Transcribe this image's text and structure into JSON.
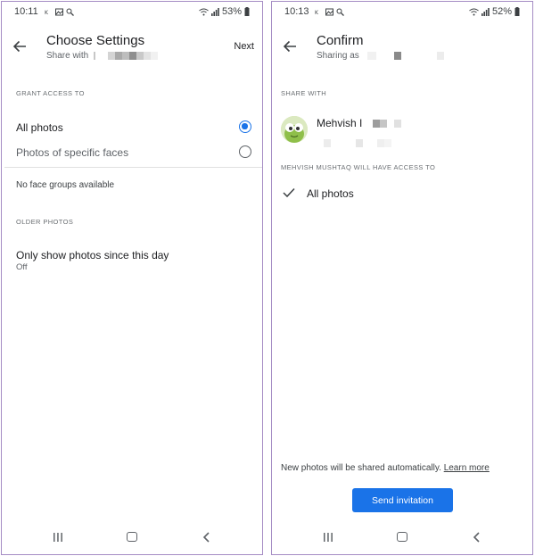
{
  "left_screen": {
    "status": {
      "time": "10:11",
      "battery": "53%"
    },
    "app_bar": {
      "title": "Choose Settings",
      "subtitle": "Share with",
      "next_label": "Next"
    },
    "grant_access": {
      "section_label": "GRANT ACCESS TO",
      "options": [
        {
          "label": "All photos",
          "selected": true
        },
        {
          "label": "Photos of specific faces",
          "selected": false
        }
      ],
      "note": "No face groups available"
    },
    "older_photos": {
      "section_label": "OLDER PHOTOS",
      "setting_title": "Only show photos since this day",
      "setting_value": "Off"
    }
  },
  "right_screen": {
    "status": {
      "time": "10:13",
      "battery": "52%"
    },
    "app_bar": {
      "title": "Confirm",
      "subtitle": "Sharing as"
    },
    "share_with": {
      "section_label": "SHARE WITH",
      "contact_name": "Mehvish I"
    },
    "access": {
      "section_label": "MEHVISH MUSHTAQ WILL HAVE ACCESS TO",
      "item": "All photos"
    },
    "footer": {
      "text": "New photos will be shared automatically.",
      "link": "Learn more",
      "button": "Send invitation"
    }
  },
  "colors": {
    "accent": "#1a73e8",
    "frame": "#a58cc4"
  }
}
